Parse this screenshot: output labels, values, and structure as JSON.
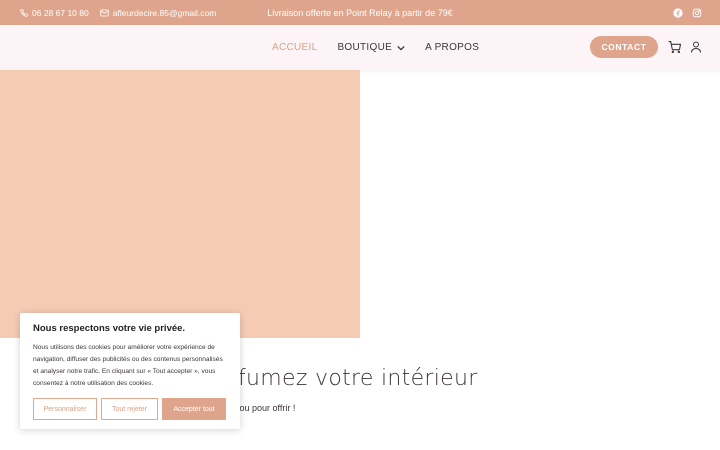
{
  "topbar": {
    "phone": "06 28 67 10 80",
    "email": "afleurdecire.85@gmail.com",
    "promo": "Livraison offerte en Point Relay à partir de 79€",
    "social_icons": [
      "facebook-icon",
      "instagram-icon"
    ]
  },
  "nav": {
    "items": [
      {
        "label": "ACCUEIL",
        "active": true
      },
      {
        "label": "BOUTIQUE",
        "active": false,
        "has_dropdown": true
      },
      {
        "label": "A PROPOS",
        "active": false
      }
    ],
    "contact_label": "CONTACT",
    "icons": [
      "cart-icon",
      "user-icon"
    ]
  },
  "hero": {
    "headline_visible": "fumez votre intérieur",
    "subline_visible": "oi ou pour offrir !"
  },
  "cookie_banner": {
    "title": "Nous respectons votre vie privée.",
    "body": "Nous utilisons des cookies pour améliorer votre expérience de navigation, diffuser des publicités ou des contenus personnalisés et analyser notre trafic. En cliquant sur « Tout accepter », vous consentez à notre utilisation des cookies.",
    "customize_label": "Personnaliser",
    "reject_label": "Tout rejeter",
    "accept_label": "Accepter tout"
  },
  "colors": {
    "accent": "#dfa58c",
    "hero_block": "#f6cbb4",
    "header_bg": "#fdf4f7"
  }
}
